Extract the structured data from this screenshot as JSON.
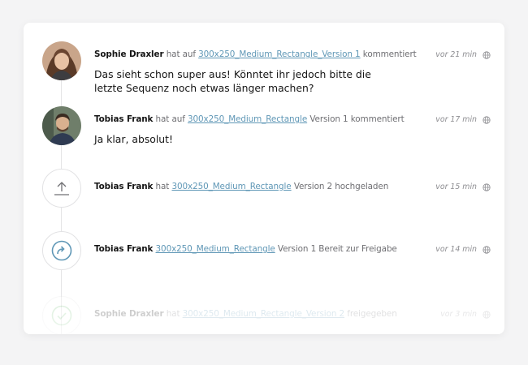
{
  "activity": [
    {
      "author": "Sophie Draxler",
      "pre_link": "hat auf",
      "link": "300x250_Medium_Rectangle_Version 1",
      "post_link": "kommentiert",
      "time": "vor 21 min",
      "comment_lines": [
        "Das sieht schon super aus! Könntet ihr jedoch bitte die",
        "letzte Sequenz noch etwas länger machen?"
      ]
    },
    {
      "author": "Tobias Frank",
      "pre_link": "hat auf",
      "link": "300x250_Medium_Rectangle",
      "post_link": "Version 1 kommentiert",
      "time": "vor 17 min",
      "comment": "Ja klar, absolut!"
    },
    {
      "author": "Tobias Frank",
      "pre_link": "hat",
      "link": "300x250_Medium_Rectangle",
      "post_link": "Version 2 hochgeladen",
      "time": "vor 15 min",
      "icon": "upload-icon"
    },
    {
      "author": "Tobias Frank",
      "pre_link": "",
      "link": "300x250_Medium_Rectangle",
      "post_link": "Version 1 Bereit zur Freigabe",
      "time": "vor 14 min",
      "icon": "share-arrow-icon"
    },
    {
      "author": "Sophie Draxler",
      "pre_link": "hat",
      "link": "300x250_Medium_Rectangle_Version 2",
      "post_link": "freigegeben",
      "time": "vor 3 min",
      "icon": "check-circle-icon"
    }
  ],
  "colors": {
    "link": "#5f97b6",
    "share_icon": "#5f97b6",
    "check_icon": "#7bc47f",
    "line": "#e4e4e6"
  }
}
